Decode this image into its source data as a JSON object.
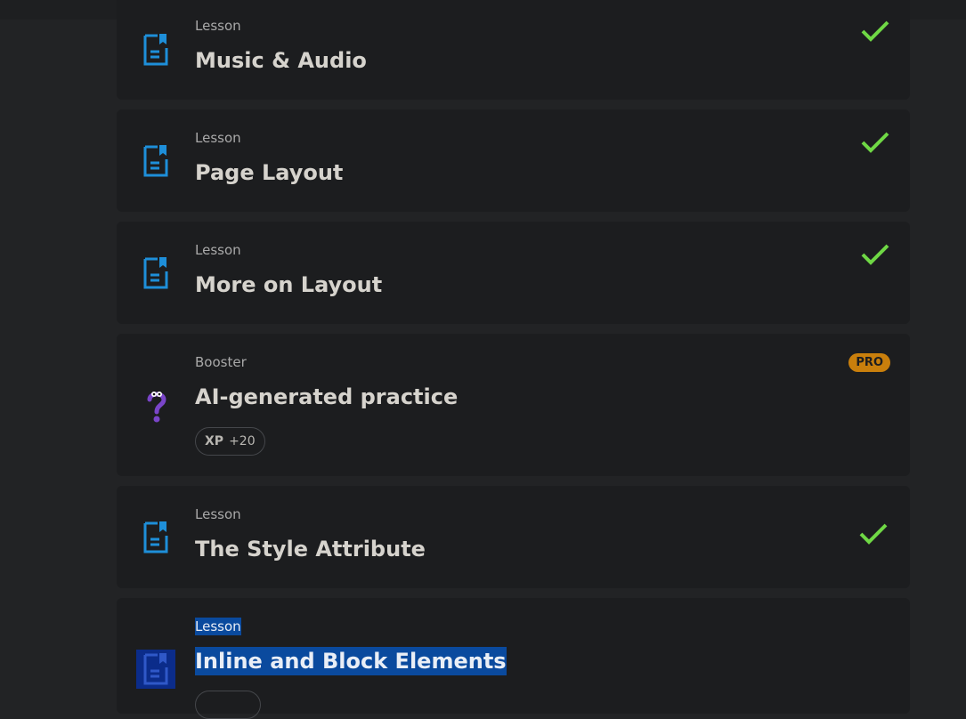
{
  "lessons": [
    {
      "type": "Lesson",
      "title": "Music & Audio",
      "completed": true
    },
    {
      "type": "Lesson",
      "title": "Page Layout",
      "completed": true
    },
    {
      "type": "Lesson",
      "title": "More on Layout",
      "completed": true
    },
    {
      "type": "Booster",
      "title": "AI-generated practice",
      "badge": "PRO",
      "xp_label": "XP",
      "xp_value": "+20"
    },
    {
      "type": "Lesson",
      "title": "The Style Attribute",
      "completed": true
    },
    {
      "type": "Lesson",
      "title": "Inline and Block Elements",
      "selected": true
    }
  ],
  "icons": {
    "lesson": "document-bookmark-icon",
    "booster": "question-mark-icon",
    "completed": "checkmark-icon"
  },
  "colors": {
    "lesson_icon": "#1e8fd9",
    "check": "#6fd845",
    "pro_badge": "#c97f0c",
    "booster_icon": "#7a45c9",
    "selection": "#0a4a9e"
  }
}
